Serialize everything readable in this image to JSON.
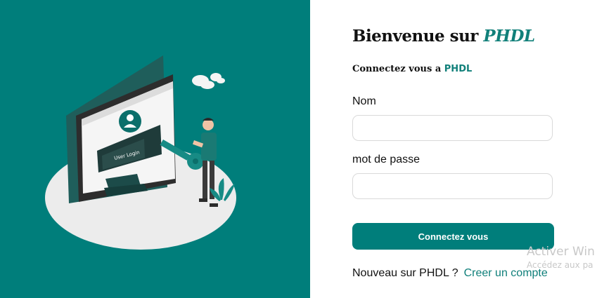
{
  "colors": {
    "accent": "#007e7b",
    "brand_text": "#11807a"
  },
  "illustration": {
    "name": "login-security-illustration",
    "screen_text": "User Login"
  },
  "header": {
    "title_prefix": "Bienvenue sur",
    "title_brand": "PHDL",
    "subtitle_prefix": "Connectez vous a",
    "subtitle_brand": "PHDL"
  },
  "form": {
    "name_label": "Nom",
    "name_value": "",
    "password_label": "mot de passe",
    "password_value": "",
    "submit_label": "Connectez vous"
  },
  "footer": {
    "prompt": "Nouveau sur PHDL ?",
    "link_label": "Creer un compte"
  },
  "watermark": {
    "line1": "Activer Win",
    "line2": "Accédez aux pa"
  }
}
